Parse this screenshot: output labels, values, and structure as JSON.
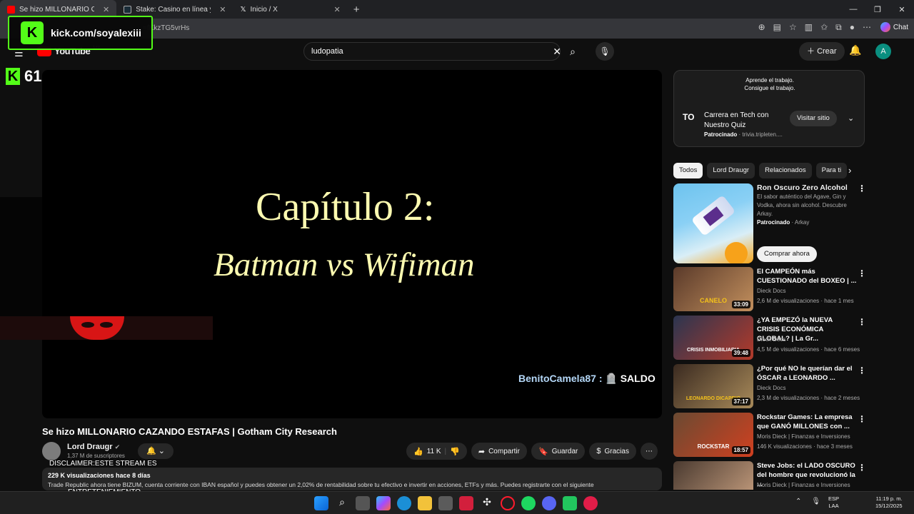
{
  "browser": {
    "tabs": [
      {
        "title": "Se hizo MILLONARIO CAZAN...",
        "active": true,
        "favicon_color": "#ff0000"
      },
      {
        "title": "Stake: Casino en línea y Apuestas",
        "active": false,
        "favicon_color": "#1a2c38"
      },
      {
        "title": "Inicio / X",
        "active": false,
        "favicon_color": "#000000"
      }
    ],
    "url_fragment": "=fKkzTG5vrHs"
  },
  "kick": {
    "url": "kick.com/soyalexiii",
    "logo_letter": "K",
    "viewer_count": "61"
  },
  "youtube": {
    "logo": "YouTube",
    "region": "MX",
    "search_query": "ludopatia",
    "create_label": "Crear",
    "avatar_letter": "A"
  },
  "video": {
    "chapter_title": "Capítulo 2:",
    "chapter_subtitle": "Batman vs Wifiman",
    "chat_user": "BenitoCamela87 :",
    "chat_text": "SALDO",
    "title": "Se hizo MILLONARIO CAZANDO ESTAFAS | Gotham City Research",
    "channel": "Lord Draugr",
    "subscribers": "1,37 M de suscriptores",
    "likes": "11 K",
    "share": "Compartir",
    "save": "Guardar",
    "thanks": "Gracias",
    "stats": "229 K visualizaciones  hace 8 días",
    "description": "Trade Republic ahora tiene BIZUM, cuenta corriente con IBAN español y puedes obtener un 2,02% de rentabilidad sobre tu efectivo e invertir en acciones, ETFs y más. Puedes registrarte con el siguiente",
    "disclaimer_1": "DISCLAIMER:ESTE STREAM ES",
    "disclaimer_2": "ENTRETENIEMIENTO"
  },
  "ad": {
    "top_line_1": "Aprende el trabajo.",
    "top_line_2": "Consigue el trabajo.",
    "logo": "TO",
    "title": "Carrera en Tech con Nuestro Quiz",
    "sponsored": "Patrocinado",
    "domain": "trivia.tripleten....",
    "visit": "Visitar sitio"
  },
  "chips": [
    "Todos",
    "Lord Draugr",
    "Relacionados",
    "Para ti"
  ],
  "sponsored_video": {
    "title": "Ron Oscuro Zero Alcohol",
    "description": "El sabor auténtico del Agave, Gin y Vodka, ahora sin alcohol. Descubre Arkay.",
    "sponsored": "Patrocinado",
    "advertiser": "Arkay",
    "cta": "Comprar ahora"
  },
  "recommendations": [
    {
      "title": "El CAMPEÓN más CUESTIONADO del BOXEO  | ...",
      "channel": "Dieck Docs",
      "meta": "2,6 M de visualizaciones · hace 1 mes",
      "duration": "33:09",
      "thumb_text": "CANELO",
      "colors": [
        "#5a3a2a",
        "#c28f5d"
      ]
    },
    {
      "title": "¿YA EMPEZÓ la NUEVA CRISIS ECONÓMICA GLOBAL? | La Gr...",
      "channel": "Dieck Docs",
      "meta": "4,5 M de visualizaciones · hace 6 meses",
      "duration": "39:48",
      "thumb_text": "CRISIS INMOBILIARIA",
      "colors": [
        "#2b3550",
        "#b33a2a"
      ]
    },
    {
      "title": "¿Por qué NO le querían dar el ÓSCAR a LEONARDO ...",
      "channel": "Dieck Docs",
      "meta": "2,3 M de visualizaciones · hace 2 meses",
      "duration": "37:17",
      "thumb_text": "LEONARDO DICAPRIO",
      "colors": [
        "#3a2a20",
        "#a88a5a"
      ]
    },
    {
      "title": "Rockstar Games: La empresa que GANÓ MILLONES con ...",
      "channel": "Moris Dieck | Finanzas e Inversiones",
      "meta": "146 K visualizaciones · hace 3 meses",
      "duration": "18:57",
      "thumb_text": "ROCKSTAR",
      "colors": [
        "#6a4a32",
        "#d04020"
      ]
    },
    {
      "title": "Steve Jobs: el LADO OSCURO del hombre que revolucionó la ...",
      "channel": "Moris Dieck | Finanzas e Inversiones",
      "meta": "",
      "duration": "",
      "thumb_text": "",
      "colors": [
        "#4a3a30",
        "#c8a080"
      ]
    }
  ],
  "taskbar": {
    "lang_1": "ESP",
    "lang_2": "LAA",
    "time": "11:19 p. m.",
    "date": "15/12/2025"
  }
}
